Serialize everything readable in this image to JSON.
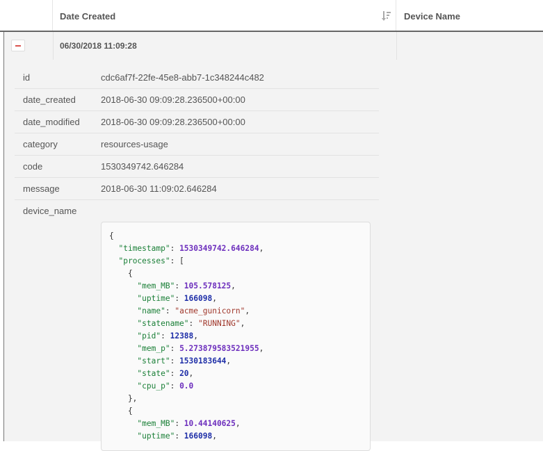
{
  "header": {
    "col_date_label": "Date Created",
    "col_device_label": "Device Name",
    "sort_icon": "sort-descending-icon"
  },
  "entry": {
    "collapse_icon": "minus-icon",
    "date_created": "06/30/2018 11:09:28",
    "device_name": "",
    "details": [
      {
        "key": "id",
        "value": "cdc6af7f-22fe-45e8-abb7-1c348244c482"
      },
      {
        "key": "date_created",
        "value": "2018-06-30 09:09:28.236500+00:00"
      },
      {
        "key": "date_modified",
        "value": "2018-06-30 09:09:28.236500+00:00"
      },
      {
        "key": "category",
        "value": "resources-usage"
      },
      {
        "key": "code",
        "value": "1530349742.646284"
      },
      {
        "key": "message",
        "value": "2018-06-30 11:09:02.646284"
      },
      {
        "key": "device_name",
        "value": ""
      }
    ],
    "json": {
      "timestamp": "1530349742.646284",
      "processes": [
        {
          "mem_MB": "105.578125",
          "uptime": "166098",
          "name": "acme_gunicorn",
          "statename": "RUNNING",
          "pid": "12388",
          "mem_p": "5.273879583521955",
          "start": "1530183644",
          "state": "20",
          "cpu_p": "0.0"
        },
        {
          "mem_MB": "10.44140625",
          "uptime": "166098"
        }
      ]
    },
    "colors": {
      "json_key": "#1a7f37",
      "json_string": "#a0372b",
      "json_float": "#6d2fbd",
      "json_int": "#1f2fa8",
      "collapse_accent": "#d9534f"
    }
  }
}
